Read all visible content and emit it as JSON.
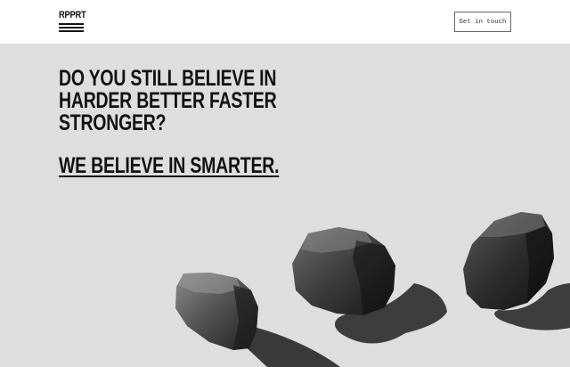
{
  "header": {
    "logo_text": "RPPRT",
    "cta_label": "Get in touch"
  },
  "hero": {
    "headline_lines": [
      "DO YOU STILL BELIEVE IN",
      "HARDER BETTER FASTER",
      "STRONGER?"
    ],
    "tagline": "WE BELIEVE IN SMARTER."
  },
  "colors": {
    "background": "#dedede",
    "header_background": "#ffffff",
    "text": "#111111"
  }
}
